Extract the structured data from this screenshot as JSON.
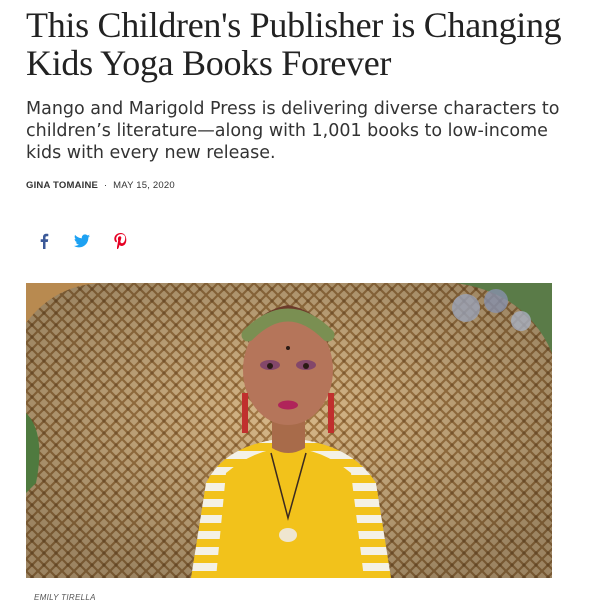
{
  "article": {
    "headline_line1": "This Children's Publisher is Changing",
    "headline_line2": "Kids Yoga Books Forever",
    "dek": "Mango and Marigold Press is delivering diverse characters to children’s literature—along with 1,001 books to low-income kids with every new release.",
    "author": "GINA TOMAINE",
    "separator": "·",
    "date": "MAY 15, 2020",
    "photo_credit": "EMILY TIRELLA"
  },
  "share": {
    "items": [
      {
        "icon": "facebook-icon",
        "color": "#3b5998"
      },
      {
        "icon": "twitter-icon",
        "color": "#1da1f2"
      },
      {
        "icon": "pinterest-icon",
        "color": "#e60023"
      }
    ]
  },
  "colors": {
    "text": "#222222",
    "shirt": "#f2c21b",
    "wicker": "#c89a5e"
  }
}
